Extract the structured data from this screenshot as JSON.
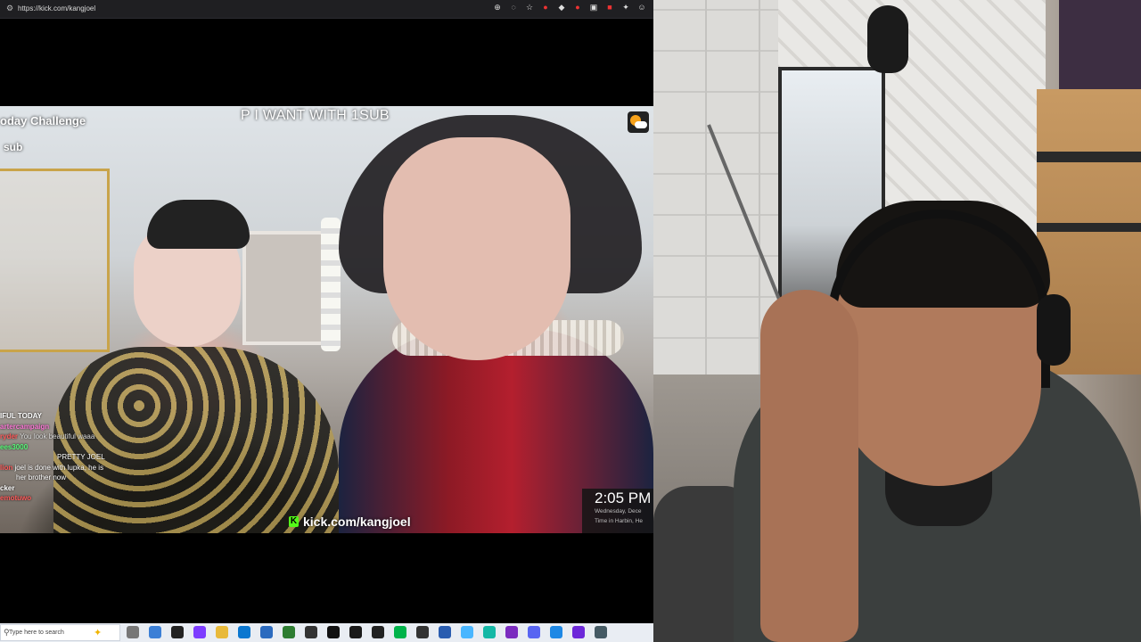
{
  "browser": {
    "url": "https://kick.com/kangjoel",
    "toolbar_icons": [
      "zoom-icon",
      "lens-icon",
      "star-icon",
      "extension-red-icon",
      "extension-flag-icon",
      "extension-dark-icon",
      "extension-box-icon",
      "extension-red2-icon",
      "puzzle-icon",
      "profile-icon"
    ]
  },
  "stream": {
    "overlay_challenge": "oday Challenge",
    "overlay_sub": "sub",
    "overlay_want": "P I WANT WITH 1SUB",
    "watermark": "kick.com/kangjoel",
    "watermark_logo": "K",
    "chat": [
      {
        "name": "IFUL TODAY",
        "text": "",
        "color": "#ffffff"
      },
      {
        "name": "artercampaign",
        "text": "",
        "color": "#ff7ad9"
      },
      {
        "name": "ryder",
        "text": "You look beautiful waaa",
        "color": "#ff5a5a"
      },
      {
        "name": "ees3000",
        "text": "",
        "color": "#58ff7a"
      },
      {
        "name": "",
        "text": "PRETTY JOEL",
        "color": "#ff5a5a"
      },
      {
        "name": "lion",
        "text": "joel is done with lupka, he is",
        "color": "#ff5a5a"
      },
      {
        "name": "",
        "text": "her brother now",
        "color": "#ffffff"
      },
      {
        "name": "cker",
        "text": "",
        "color": "#ffffff"
      },
      {
        "name": "emotuwo",
        "text": "",
        "color": "#ff5a5a"
      }
    ],
    "clock": {
      "time": "2:05 PM",
      "date": "Wednesday, Dece",
      "timezone": "Time in Harbin, He"
    }
  },
  "taskbar": {
    "search_placeholder": "Type here to search",
    "app_colors": [
      "#777",
      "#3b7fd6",
      "#222",
      "#7d3cff",
      "#e8b93a",
      "#0b77d0",
      "#2c6bbf",
      "#2e7d32",
      "#333",
      "#111",
      "#1a1a1a",
      "#222",
      "#00b34a",
      "#333",
      "#2a5db0",
      "#49b6ff",
      "#14b8a6",
      "#7b2cbf",
      "#5865f2",
      "#1e88e5",
      "#6d28d9",
      "#455a64"
    ]
  }
}
